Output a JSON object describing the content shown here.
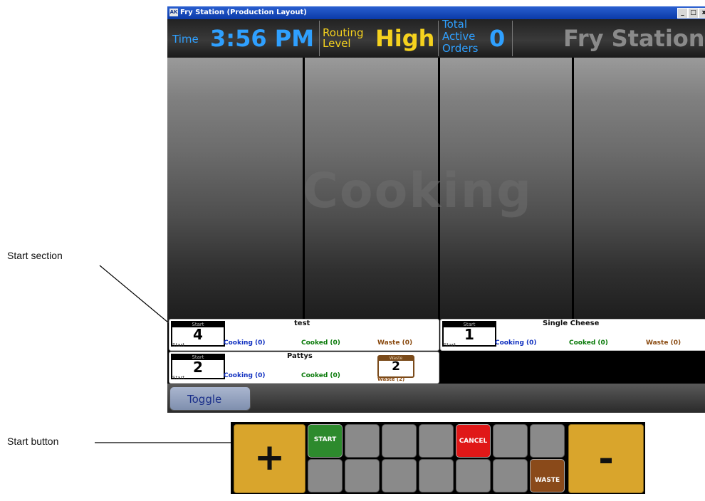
{
  "annotations": {
    "start_section": "Start section",
    "start_button": "Start button"
  },
  "window": {
    "app_icon": "AK",
    "title": "Fry Station (Production Layout)",
    "controls": [
      "_",
      "□",
      "x"
    ]
  },
  "header": {
    "time_label": "Time",
    "time_value": "3:56 PM",
    "routing_label_1": "Routing",
    "routing_label_2": "Level",
    "routing_value": "High",
    "orders_label_1": "Total",
    "orders_label_2": "Active",
    "orders_label_3": "Orders",
    "orders_value": "0",
    "station_name": "Fry Station"
  },
  "board": {
    "watermark": "Cooking"
  },
  "cards": [
    {
      "name": "test",
      "start_caption": "Start",
      "start_count": "4",
      "start_sub": "Start",
      "cooking": "Cooking (0)",
      "cooked": "Cooked (0)",
      "waste": "Waste (0)"
    },
    {
      "name": "Single Cheese",
      "start_caption": "Start",
      "start_count": "1",
      "start_sub": "Start",
      "cooking": "Cooking (0)",
      "cooked": "Cooked (0)",
      "waste": "Waste (0)"
    },
    {
      "name": "Pattys",
      "start_caption": "Start",
      "start_count": "2",
      "start_sub": "Start",
      "cooking": "Cooking (0)",
      "cooked": "Cooked (0)",
      "waste_caption": "Waste",
      "waste_count": "2",
      "waste": "Waste (2)"
    }
  ],
  "bottom": {
    "toggle_label": "Toggle"
  },
  "keypad": {
    "plus": "+",
    "minus": "-",
    "start": "START",
    "cancel": "CANCEL",
    "waste": "WASTE"
  }
}
